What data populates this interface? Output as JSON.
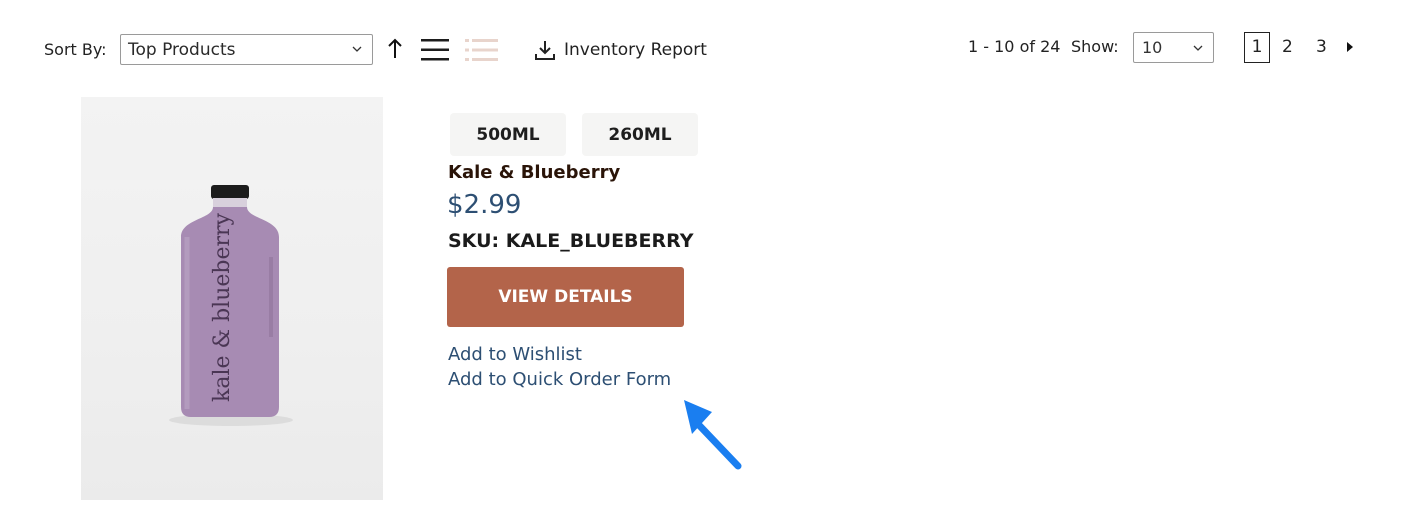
{
  "toolbar": {
    "sort_label": "Sort By:",
    "sort_value": "Top Products",
    "inventory_report_label": "Inventory Report",
    "range_text": "1 - 10 of 24",
    "show_label": "Show:",
    "show_value": "10",
    "pages": [
      "1",
      "2",
      "3"
    ],
    "current_page": "1",
    "icons": {
      "sort_direction": "arrow-up-icon",
      "list_view": "list-view-icon",
      "detail_view": "detail-list-view-icon",
      "download": "download-icon",
      "next": "caret-right-icon"
    }
  },
  "product": {
    "image_text": "kale & blueberry",
    "variants": [
      "500ML",
      "260ML"
    ],
    "name": "Kale & Blueberry",
    "price": "$2.99",
    "sku": "SKU: KALE_BLUEBERRY",
    "view_details_label": "VIEW DETAILS",
    "wishlist_label": "Add to Wishlist",
    "quick_order_label": "Add to Quick Order Form"
  },
  "colors": {
    "accent_button": "#b3644a",
    "link": "#2d4f73",
    "variant_bg": "#f5f5f4",
    "annotation_arrow": "#1a7ef0",
    "bottle": "#a78bb3"
  }
}
